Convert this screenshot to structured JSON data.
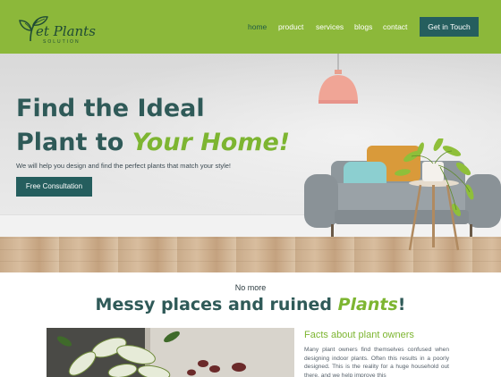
{
  "brand": {
    "name": "et Plants",
    "tagline": "SOLUTION"
  },
  "nav": {
    "items": [
      {
        "label": "home",
        "active": true
      },
      {
        "label": "product",
        "active": false
      },
      {
        "label": "services",
        "active": false
      },
      {
        "label": "blogs",
        "active": false
      },
      {
        "label": "contact",
        "active": false
      }
    ],
    "cta_label": "Get in Touch"
  },
  "hero": {
    "title_line1": "Find the Ideal",
    "title_line2_plain": "Plant to ",
    "title_line2_accent": "Your Home!",
    "subtitle": "We will help you design and find the perfect plants that match your style!",
    "button_label": "Free Consultation"
  },
  "section": {
    "kicker": "No more",
    "title_plain": "Messy places and ruined ",
    "title_accent": "Plants",
    "title_end": "!"
  },
  "facts": {
    "title": "Facts about plant owners",
    "body": "Many plant owners find themselves confused when designing indoor plants. Often this results in a poorly designed. This is the reality for a huge household out there, and we help improve this"
  },
  "colors": {
    "nav_green": "#8cb83a",
    "dark_teal": "#255e5e",
    "heading_teal": "#2f5a58",
    "accent_green": "#7db531"
  }
}
